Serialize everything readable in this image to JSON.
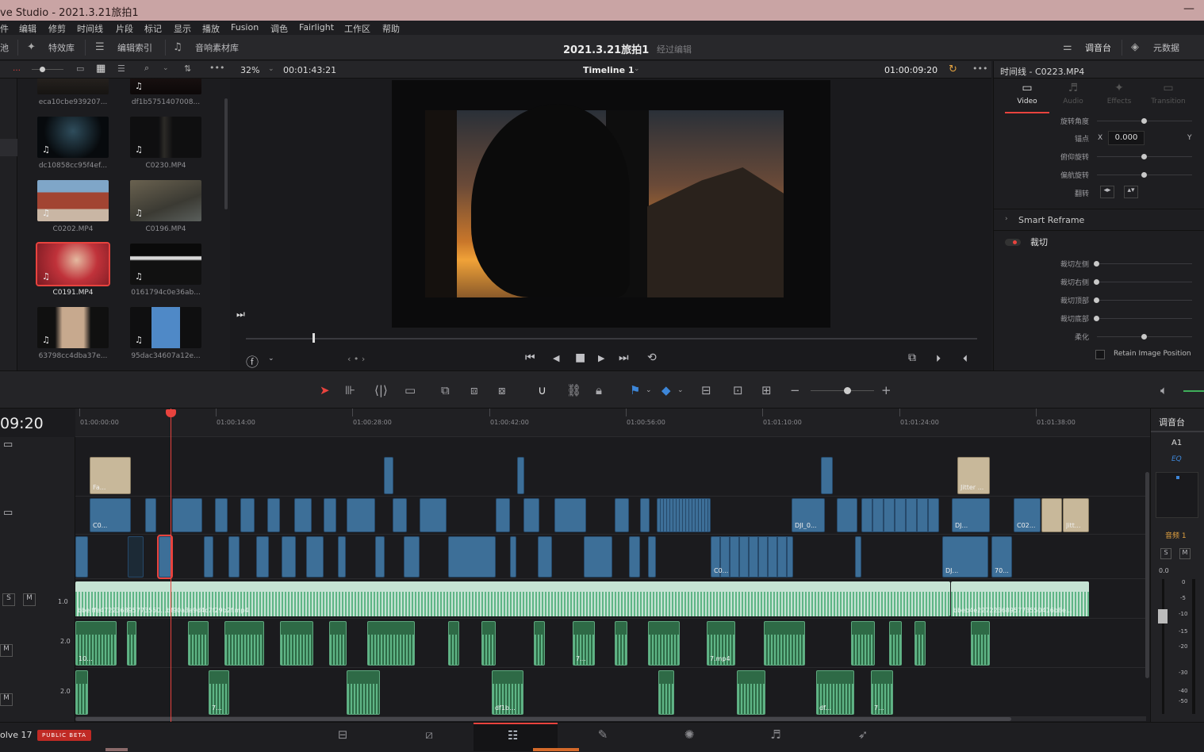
{
  "window": {
    "title": "ve Studio - 2021.3.21旅拍1",
    "minimize": "—"
  },
  "menu": [
    "件",
    "编辑",
    "修剪",
    "时间线",
    "片段",
    "标记",
    "显示",
    "播放",
    "Fusion",
    "调色",
    "Fairlight",
    "工作区",
    "帮助"
  ],
  "toolbar": {
    "left_cut": "池",
    "effects_library": "特效库",
    "edit_index": "编辑索引",
    "sound_library": "音响素材库",
    "project_name": "2021.3.21旅拍1",
    "project_status": "经过编辑",
    "mixer": "调音台",
    "metadata": "元数据"
  },
  "viewer": {
    "zoom": "32%",
    "source_timecode": "00:01:43:21",
    "timeline_name": "Timeline 1",
    "record_timecode": "01:00:09:20"
  },
  "media_pool": {
    "clips": [
      {
        "name": "eca10cbe939207...",
        "icon": "music-note-icon"
      },
      {
        "name": "df1b5751407008...",
        "icon": "music-note-icon"
      },
      {
        "name": "dc10858cc95f4ef...",
        "icon": "music-note-icon"
      },
      {
        "name": "C0230.MP4",
        "icon": "music-note-icon"
      },
      {
        "name": "C0202.MP4",
        "icon": "music-note-icon"
      },
      {
        "name": "C0196.MP4",
        "icon": "music-note-icon"
      },
      {
        "name": "C0191.MP4",
        "icon": "music-note-icon"
      },
      {
        "name": "0161794c0e36ab...",
        "icon": "music-note-icon"
      },
      {
        "name": "63798cc4dba37e...",
        "icon": "music-note-icon"
      },
      {
        "name": "95dac34607a12e...",
        "icon": "music-note-icon"
      }
    ]
  },
  "inspector": {
    "header": "时间线 - C0223.MP4",
    "tabs": [
      "Video",
      "Audio",
      "Effects",
      "Transition"
    ],
    "params": [
      {
        "label": "旋转角度"
      },
      {
        "label": "锚点",
        "x_label": "X",
        "x_value": "0.000",
        "y_label": "Y"
      },
      {
        "label": "俯仰旋转"
      },
      {
        "label": "偏航旋转"
      },
      {
        "label": "翻转"
      }
    ],
    "smart_reframe": "Smart Reframe",
    "crop_section": "裁切",
    "crop_params": [
      {
        "label": "裁切左侧"
      },
      {
        "label": "裁切右侧"
      },
      {
        "label": "裁切顶部"
      },
      {
        "label": "裁切底部"
      },
      {
        "label": "柔化"
      }
    ],
    "retain": "Retain Image Position"
  },
  "timeline": {
    "current_tc": "09:20",
    "ruler": [
      "01:00:00:00",
      "01:00:14:00",
      "01:00:28:00",
      "01:00:42:00",
      "01:00:56:00",
      "01:01:10:00",
      "01:01:24:00",
      "01:01:38:00"
    ],
    "audio_levels": [
      "1.0",
      "2.0",
      "2.0"
    ],
    "track_buttons": {
      "solo": "S",
      "mute": "M"
    },
    "clip_labels": {
      "v3a": "Fa...",
      "v3b": "Jitter ...",
      "v2a": "C0...",
      "v2b": "DJI_0...",
      "v2c": "DJ...",
      "v2d": "C02...",
      "v2e": "Jitt...",
      "v1a": "C0...",
      "v1b": "DJ...",
      "v1c": "70...",
      "a1a": "bbe ffe472236895773550...bf90a3a9d4c7f29b2f.mp4",
      "a1b": "bbeb4e2272236895773550416b8e...",
      "a2a": "10...",
      "a2b": "7...",
      "a2c": "7.mp4",
      "a3a": "7...",
      "a3b": "df1b...",
      "a3c": "df...",
      "a3d": "7..."
    }
  },
  "mixer": {
    "title": "调音台",
    "channel": "A1",
    "eq": "EQ",
    "track": "音频 1",
    "db_labels": [
      "0.0",
      "0",
      "-5",
      "-10",
      "-15",
      "-20",
      "-30",
      "-40",
      "-50"
    ]
  },
  "bottom": {
    "app": "olve 17",
    "beta": "PUBLIC BETA",
    "pages": [
      "media-page-icon",
      "cut-page-icon",
      "edit-page-icon",
      "fusion-page-icon",
      "color-page-icon",
      "fairlight-page-icon",
      "deliver-page-icon"
    ]
  },
  "colors": {
    "accent": "#e8433e",
    "video_clip": "#3d6f98",
    "audio_clip": "#c6e3d4",
    "audio_wave": "#5fb586"
  }
}
